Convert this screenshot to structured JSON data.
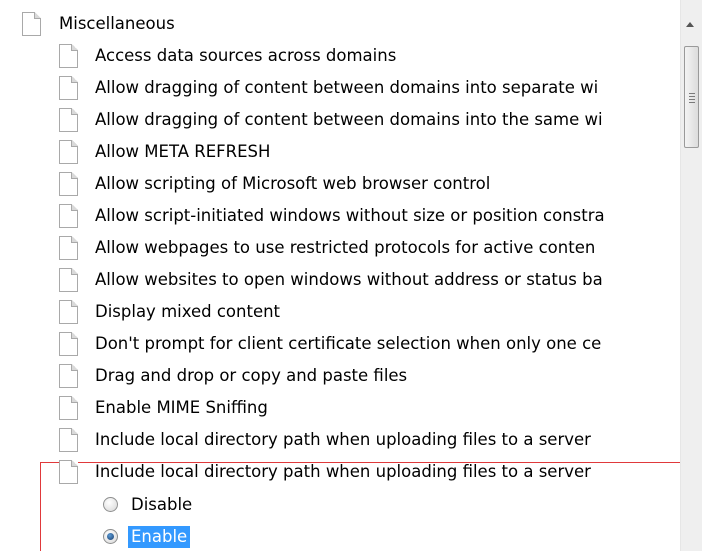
{
  "tree": {
    "parent": {
      "label": "Miscellaneous"
    },
    "items": [
      {
        "label": "Access data sources across domains"
      },
      {
        "label": "Allow dragging of content between domains into separate wi"
      },
      {
        "label": "Allow dragging of content between domains into the same wi"
      },
      {
        "label": "Allow META REFRESH"
      },
      {
        "label": "Allow scripting of Microsoft web browser control"
      },
      {
        "label": "Allow script-initiated windows without size or position constra"
      },
      {
        "label": "Allow webpages to use restricted protocols for active conten"
      },
      {
        "label": "Allow websites to open windows without address or status ba"
      },
      {
        "label": "Display mixed content"
      },
      {
        "label": "Don't prompt for client certificate selection when only one ce"
      },
      {
        "label": "Drag and drop or copy and paste files"
      },
      {
        "label": "Enable MIME Sniffing"
      },
      {
        "label": "Include local directory path when uploading files to a server"
      },
      {
        "label": "Include local directory path when uploading files to a server"
      }
    ],
    "options": [
      {
        "label": "Disable",
        "checked": false
      },
      {
        "label": "Enable",
        "checked": true
      }
    ]
  },
  "colors": {
    "selection": "#3399ff",
    "highlight_border": "#e0393b"
  }
}
